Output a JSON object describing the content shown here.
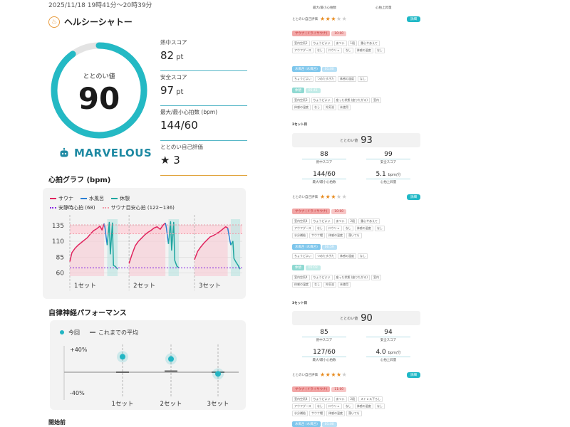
{
  "header": {
    "datetime": "2025/11/18 19時41分〜20時39分",
    "program_name": "ヘルシーシャトー"
  },
  "totonoi": {
    "label": "ととのい値",
    "value": "90",
    "level": 0.9,
    "rating_text": "MARVELOUS",
    "colors": {
      "ring": "#24b9c4",
      "track": "#e3e3e3",
      "brand": "#1f8aa3"
    }
  },
  "scores": [
    {
      "label": "熱中スコア",
      "value": "82",
      "unit": "pt"
    },
    {
      "label": "安全スコア",
      "value": "97",
      "unit": "pt"
    },
    {
      "label": "最大/最小心拍数 (bpm)",
      "value": "144/60",
      "unit": ""
    },
    {
      "label": "ととのい自己評価",
      "value": "★ 3",
      "unit": ""
    }
  ],
  "heart_rate": {
    "title": "心拍グラフ (bpm)",
    "legend": [
      "サウナ",
      "水風呂",
      "休憩",
      "安静時心拍 (68)",
      "サウナ目安心拍 (122~136)"
    ],
    "y_ticks": [
      "135",
      "110",
      "85",
      "60"
    ],
    "set_labels": [
      "1セット",
      "2セット",
      "3セット"
    ],
    "colors": {
      "sauna": "#e0245e",
      "water": "#2a7fd4",
      "rest": "#1fa6a0",
      "resting": "#8a2be2",
      "target": "#f29aa8"
    }
  },
  "chart_data": [
    {
      "type": "line",
      "title": "心拍グラフ (bpm)",
      "xlabel": "",
      "ylabel": "",
      "ylim": [
        55,
        145
      ],
      "y_ticks": [
        60,
        85,
        110,
        135
      ],
      "legend": [
        "サウナ",
        "水風呂",
        "休憩",
        "安静時心拍 (68)",
        "サウナ目安心拍 (122~136)"
      ],
      "reference_lines": {
        "resting": 68,
        "target_band": [
          122,
          136
        ]
      },
      "sets": [
        "1セット",
        "2セット",
        "3セット"
      ],
      "series": [
        {
          "name": "サウナ",
          "segments": [
            [
              [
                0,
                78
              ],
              [
                2,
                92
              ],
              [
                5,
                99
              ],
              [
                8,
                104
              ],
              [
                11,
                108
              ],
              [
                14,
                112
              ],
              [
                17,
                116
              ],
              [
                20,
                122
              ],
              [
                23,
                127
              ],
              [
                26,
                130
              ],
              [
                29,
                134
              ],
              [
                31,
                128
              ],
              [
                33,
                138
              ]
            ],
            [
              [
                57,
                75
              ],
              [
                60,
                90
              ],
              [
                63,
                103
              ],
              [
                66,
                110
              ],
              [
                69,
                115
              ],
              [
                72,
                120
              ],
              [
                75,
                124
              ],
              [
                78,
                127
              ],
              [
                81,
                131
              ],
              [
                84,
                133
              ],
              [
                87,
                129
              ],
              [
                90,
                136
              ],
              [
                92,
                139
              ]
            ],
            [
              [
                120,
                81
              ],
              [
                123,
                94
              ],
              [
                126,
                101
              ],
              [
                129,
                107
              ],
              [
                132,
                112
              ],
              [
                135,
                117
              ],
              [
                138,
                119
              ],
              [
                141,
                122
              ],
              [
                144,
                125
              ],
              [
                147,
                129
              ],
              [
                150,
                133
              ],
              [
                152,
                131
              ]
            ]
          ]
        },
        {
          "name": "水風呂",
          "segments": [
            [
              [
                33,
                138
              ],
              [
                34,
                130
              ],
              [
                35,
                116
              ],
              [
                36,
                104
              ]
            ],
            [
              [
                92,
                139
              ],
              [
                93,
                131
              ],
              [
                94,
                118
              ],
              [
                95,
                106
              ]
            ],
            [
              [
                152,
                131
              ],
              [
                153,
                122
              ],
              [
                154,
                112
              ],
              [
                155,
                104
              ]
            ]
          ]
        },
        {
          "name": "休憩",
          "segments": [
            [
              [
                36,
                104
              ],
              [
                38,
                140
              ],
              [
                39,
                90
              ],
              [
                41,
                139
              ],
              [
                42,
                72
              ],
              [
                44,
                70
              ],
              [
                46,
                66
              ]
            ],
            [
              [
                95,
                106
              ],
              [
                97,
                141
              ],
              [
                98,
                96
              ],
              [
                100,
                140
              ],
              [
                101,
                80
              ],
              [
                103,
                71
              ],
              [
                105,
                68
              ]
            ],
            [
              [
                155,
                104
              ],
              [
                157,
                110
              ],
              [
                158,
                83
              ],
              [
                160,
                77
              ],
              [
                162,
                72
              ],
              [
                164,
                66
              ]
            ]
          ]
        }
      ]
    },
    {
      "type": "scatter",
      "title": "自律神経パフォーマンス",
      "categories": [
        "1セット",
        "2セット",
        "3セット"
      ],
      "ylim": [
        -40,
        40
      ],
      "y_ticks": [
        "+40%",
        "-40%"
      ],
      "series": [
        {
          "name": "今回",
          "values": [
            28,
            24,
            -3
          ]
        },
        {
          "name": "これまでの平均",
          "values": [
            0,
            2,
            0
          ]
        }
      ]
    }
  ],
  "anp": {
    "title": "自律神経パフォーマンス",
    "legend_current": "今回",
    "legend_avg": "これまでの平均",
    "y_top": "+40%",
    "y_bottom": "-40%",
    "sets": [
      "1セット",
      "2セット",
      "3セット"
    ]
  },
  "next_section": "開始前",
  "right": {
    "top_stat_cap_left": "最大/最小心拍数",
    "top_stat_cap_right": "心拍上昇量",
    "set1_eval": {
      "label": "ととのい自己評価",
      "stars": 3,
      "button": "詳細",
      "sauna_tag": "サウナ (ドライサウナ)",
      "sauna_time": "10:00",
      "sauna_chips": [
        "室内空気2",
        "ちょうどよい",
        "あつい",
        "1段",
        "重心やあえて"
      ],
      "sauna_chips2": [
        "アウフグース",
        "なし",
        "ロウリュ",
        "なし",
        "体感の温度",
        "なし"
      ],
      "water_tag": "水風呂 (水風呂)",
      "water_time": "01:00",
      "water_chips": [
        "ちょうどよい",
        "つめたすぎた",
        "体感の温度",
        "なし"
      ],
      "rest_tag": "休憩",
      "rest_time": "05:41",
      "rest_chips": [
        "室内空気3",
        "ちょうどよい",
        "座った状態 (座りたがる)",
        "室内"
      ],
      "rest_chips2": [
        "体感の温度",
        "なし",
        "外気浴",
        "未使用"
      ]
    },
    "set2": {
      "title": "2セット目",
      "totonoi_label": "ととのい値",
      "totonoi_value": "93",
      "stats": [
        {
          "num": "88",
          "unit": "",
          "cap": "熱中スコア"
        },
        {
          "num": "99",
          "unit": "",
          "cap": "安全スコア"
        },
        {
          "num": "144/60",
          "unit": "",
          "cap": "最大/最小心拍数"
        },
        {
          "num": "5.1",
          "unit": "bpm/分",
          "cap": "心拍上昇量"
        }
      ],
      "eval_label": "ととのい自己評価",
      "stars": 3,
      "button": "詳細",
      "sauna_tag": "サウナ (ドライサウナ)",
      "sauna_time": "10:00",
      "sauna_chips": [
        "室内空気4",
        "ちょうどよい",
        "あつい",
        "2段",
        "重心やあえて"
      ],
      "sauna_chips2": [
        "アウフグース",
        "なし",
        "ロウリュ",
        "なし",
        "体感の温度",
        "なし"
      ],
      "sauna_chips3": [
        "水分補給",
        "サウナ帽",
        "体感の温度",
        "落いても"
      ],
      "water_tag": "水風呂 (水風呂)",
      "water_time": "00:59",
      "water_chips": [
        "ちょうどよい",
        "つめたすぎた",
        "体感の温度",
        "なし"
      ],
      "rest_tag": "休憩",
      "rest_time": "05:03",
      "rest_chips": [
        "室内空気4",
        "ちょうどよい",
        "座った状態 (座りたがる)",
        "室内"
      ],
      "rest_chips2": [
        "体感の温度",
        "なし",
        "外気浴",
        "未使用"
      ]
    },
    "set3": {
      "title": "3セット目",
      "totonoi_label": "ととのい値",
      "totonoi_value": "90",
      "stats": [
        {
          "num": "85",
          "unit": "",
          "cap": "熱中スコア"
        },
        {
          "num": "94",
          "unit": "",
          "cap": "安全スコア"
        },
        {
          "num": "127/60",
          "unit": "",
          "cap": "最大/最小心拍数"
        },
        {
          "num": "4.0",
          "unit": "bpm/分",
          "cap": "心拍上昇量"
        }
      ],
      "eval_label": "ととのい自己評価",
      "stars": 4,
      "button": "詳細",
      "sauna_tag": "サウナ (ドライサウナ)",
      "sauna_time": "11:00",
      "sauna_chips": [
        "室内空気4",
        "ちょうどよい",
        "あつい",
        "2段",
        "ストレス下ろし"
      ],
      "sauna_chips2": [
        "アウフグース",
        "なし",
        "ロウリュ",
        "なし",
        "体感の温度",
        "なし"
      ],
      "sauna_chips3": [
        "水分補給",
        "サウナ帽",
        "体感の温度",
        "落いても"
      ],
      "water_tag": "水風呂 (水風呂)",
      "water_time": "01:00"
    }
  }
}
